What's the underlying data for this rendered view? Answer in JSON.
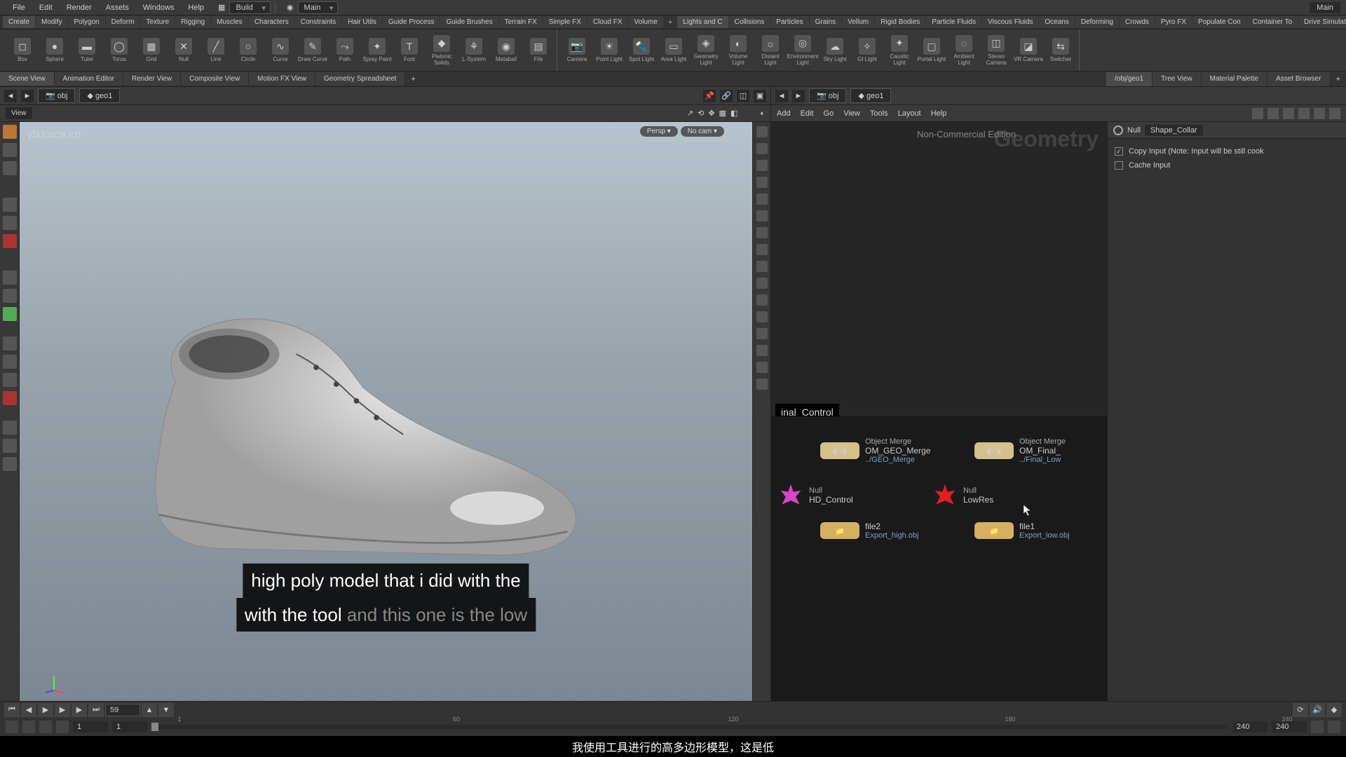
{
  "menubar": {
    "items": [
      "File",
      "Edit",
      "Render",
      "Assets",
      "Windows",
      "Help"
    ],
    "desktop_label": "Build",
    "main_label": "Main",
    "right_label": "Main"
  },
  "shelf_tabs": [
    "Create",
    "Modify",
    "Polygon",
    "Deform",
    "Texture",
    "Rigging",
    "Muscles",
    "Characters",
    "Constraints",
    "Hair Utils",
    "Guide Process",
    "Guide Brushes",
    "Terrain FX",
    "Simple FX",
    "Cloud FX",
    "Volume",
    "+",
    "Lights and C",
    "Collisions",
    "Particles",
    "Grains",
    "Vellum",
    "Rigid Bodies",
    "Particle Fluids",
    "Viscous Fluids",
    "Oceans",
    "Deforming",
    "Crowds",
    "Pyro FX",
    "Populate Con",
    "Container To",
    "Drive Simulation"
  ],
  "shelf_tools": [
    {
      "label": "Box",
      "icon": "◻"
    },
    {
      "label": "Sphere",
      "icon": "●"
    },
    {
      "label": "Tube",
      "icon": "▬"
    },
    {
      "label": "Torus",
      "icon": "◯"
    },
    {
      "label": "Grid",
      "icon": "▦"
    },
    {
      "label": "Null",
      "icon": "✕"
    },
    {
      "label": "Line",
      "icon": "╱"
    },
    {
      "label": "Circle",
      "icon": "○"
    },
    {
      "label": "Curve",
      "icon": "∿"
    },
    {
      "label": "Draw Curve",
      "icon": "✎"
    },
    {
      "label": "Path",
      "icon": "⤳"
    },
    {
      "label": "Spray Paint",
      "icon": "✦"
    },
    {
      "label": "Font",
      "icon": "T"
    },
    {
      "label": "Platonic Solids",
      "icon": "◆"
    },
    {
      "label": "L-System",
      "icon": "⚘"
    },
    {
      "label": "Metaball",
      "icon": "◉"
    },
    {
      "label": "File",
      "icon": "▤"
    }
  ],
  "shelf_lights": [
    {
      "label": "Camera",
      "icon": "📷"
    },
    {
      "label": "Point Light",
      "icon": "☀"
    },
    {
      "label": "Spot Light",
      "icon": "🔦"
    },
    {
      "label": "Area Light",
      "icon": "▭"
    },
    {
      "label": "Geometry Light",
      "icon": "◈"
    },
    {
      "label": "Volume Light",
      "icon": "◐"
    },
    {
      "label": "Distant Light",
      "icon": "☼"
    },
    {
      "label": "Environment Light",
      "icon": "◎"
    },
    {
      "label": "Sky Light",
      "icon": "☁"
    },
    {
      "label": "GI Light",
      "icon": "✧"
    },
    {
      "label": "Caustic Light",
      "icon": "✦"
    },
    {
      "label": "Portal Light",
      "icon": "▢"
    },
    {
      "label": "Ambient Light",
      "icon": "◌"
    },
    {
      "label": "Stereo Camera",
      "icon": "◫"
    },
    {
      "label": "VR Camera",
      "icon": "◪"
    },
    {
      "label": "Switcher",
      "icon": "⇆"
    }
  ],
  "pane_tabs_left": [
    "Scene View",
    "Animation Editor",
    "Render View",
    "Composite View",
    "Motion FX View",
    "Geometry Spreadsheet"
  ],
  "pane_tabs_right": [
    "/obj/geo1",
    "Tree View",
    "Material Palette",
    "Asset Browser"
  ],
  "path": {
    "crumb1": "obj",
    "crumb2": "geo1"
  },
  "view": {
    "label": "View",
    "persp": "Persp ▾",
    "nocam": "No cam ▾",
    "watermark": "vfxforce.cn"
  },
  "net_menu": [
    "Add",
    "Edit",
    "Go",
    "View",
    "Tools",
    "Layout",
    "Help"
  ],
  "net": {
    "edition": "Non-Commercial Edition",
    "geom_label": "Geometry",
    "control_label": "inal_Control",
    "nodes": {
      "om1": {
        "type": "Object Merge",
        "name": "OM_GEO_Merge",
        "path": "../GEO_Merge"
      },
      "om2": {
        "type": "Object Merge",
        "name": "OM_Final_",
        "path": "../Final_Low"
      },
      "null1": {
        "type": "Null",
        "name": "HD_Control"
      },
      "null2": {
        "type": "Null",
        "name": "LowRes"
      },
      "file1": {
        "name": "file2",
        "path": "Export_high.obj"
      },
      "file2": {
        "name": "file1",
        "path": "Export_low.obj"
      }
    }
  },
  "params": {
    "type": "Null",
    "name": "Shape_Collar",
    "copy_input": "Copy Input (Note: Input will be still cook",
    "cache_input": "Cache Input"
  },
  "timeline": {
    "current": "59",
    "labels": [
      "1",
      "60",
      "120",
      "180",
      "240"
    ],
    "start1": "1",
    "start2": "1",
    "end1": "240",
    "end2": "240"
  },
  "subtitle": {
    "line1": "high poly model that i did with the",
    "line2_a": "with the tool ",
    "line2_b": "and this one is the low"
  },
  "cn_subtitle": "我使用工具进行的高多边形模型，这是低"
}
